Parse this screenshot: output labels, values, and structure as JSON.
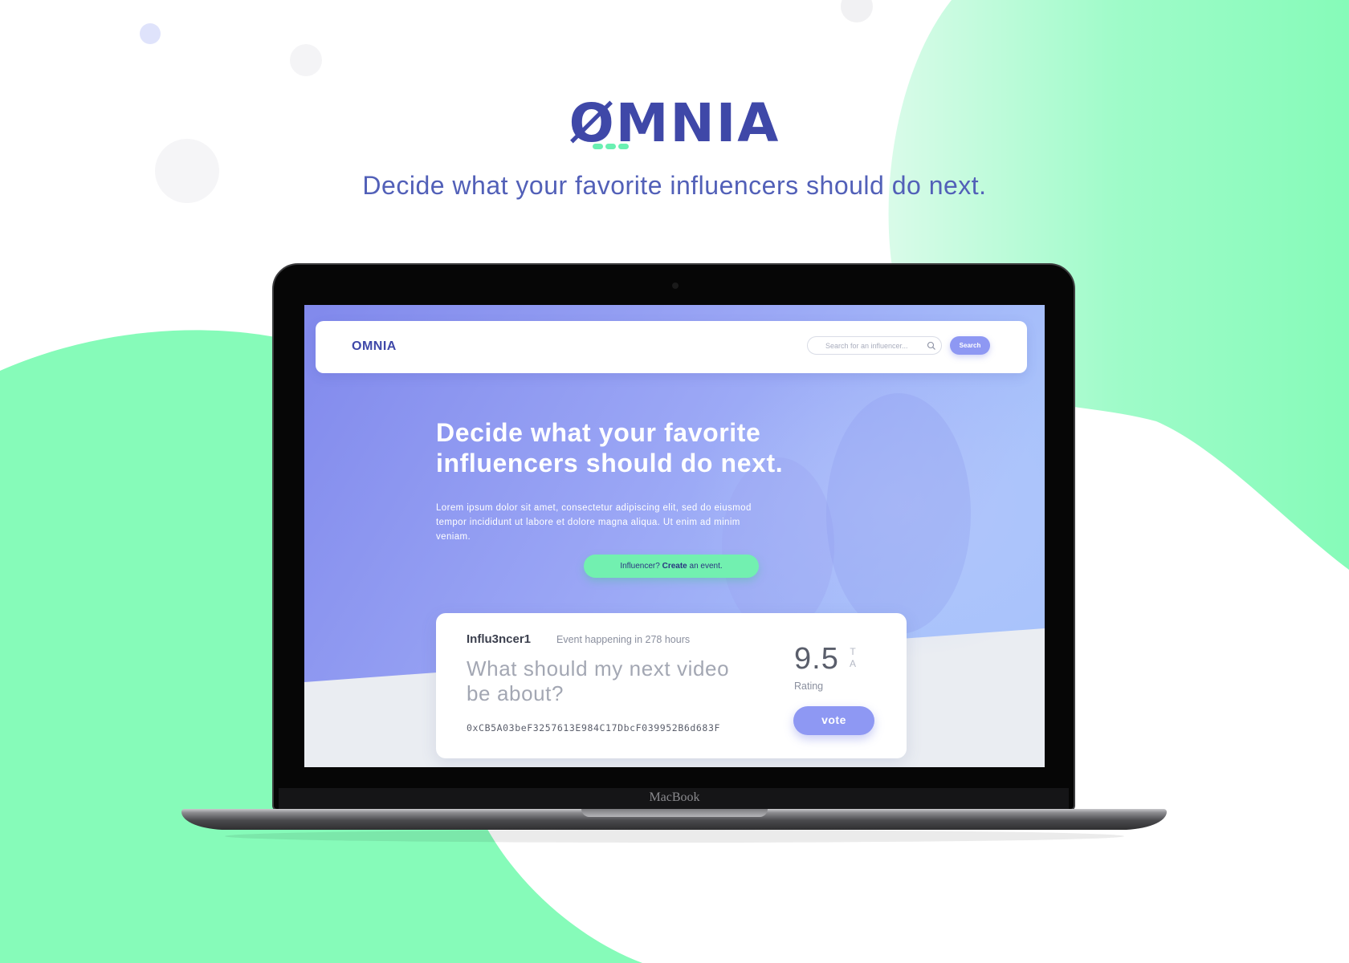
{
  "brand": {
    "logo_text": "ØMNIA",
    "tagline": "Decide what your favorite influencers should do next."
  },
  "device": {
    "brand_label": "MacBook"
  },
  "app": {
    "nav": {
      "logo_text": "OMNIA",
      "search_placeholder": "Search for an influencer...",
      "search_button_label": "Search"
    },
    "hero": {
      "title": "Decide what your favorite influencers should do next.",
      "body": "Lorem ipsum dolor sit amet, consectetur adipiscing elit, sed do eiusmod tempor incididunt ut labore et dolore magna aliqua. Ut enim ad minim veniam.",
      "cta_prefix": "Influencer? ",
      "cta_bold": "Create",
      "cta_suffix": " an event."
    },
    "event_card": {
      "username": "Influ3ncer1",
      "time_text": "Event happening in 278 hours",
      "question": "What should my next video be about?",
      "address": "0xCB5A03beF3257613E984C17DbcF039952B6d683F",
      "rating_value": "9.5",
      "rating_label": "Rating",
      "rating_arrow_up": "T",
      "rating_arrow_down": "A",
      "vote_label": "vote"
    }
  },
  "colors": {
    "brand_blue": "#3f48a8",
    "accent_green": "#72f0b0",
    "accent_purple": "#8e98f3",
    "background_green": "#86fbb9"
  },
  "icons": [
    "search-icon"
  ]
}
